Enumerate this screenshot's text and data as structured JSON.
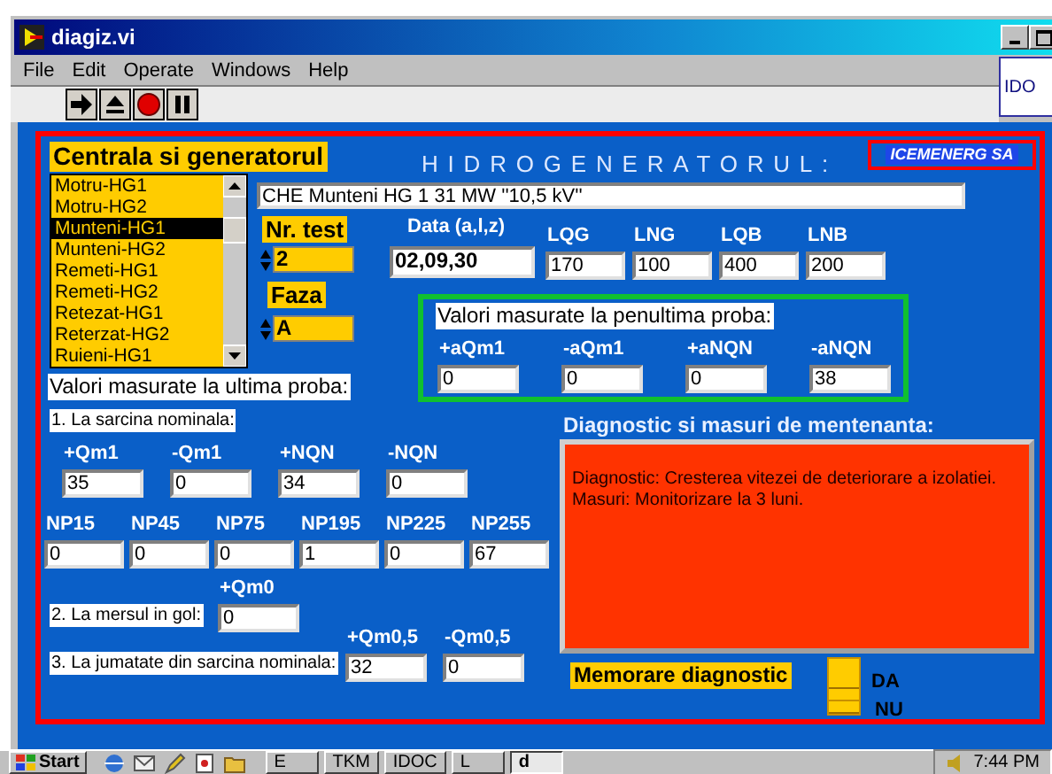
{
  "window": {
    "title": "diagiz.vi"
  },
  "menu": [
    "File",
    "Edit",
    "Operate",
    "Windows",
    "Help"
  ],
  "side_box": {
    "text": "IDO"
  },
  "panel": {
    "station_label": "Centrala si generatorul",
    "heading": "HIDROGENERATORUL:",
    "company": "ICEMENERG SA",
    "generators": [
      {
        "label": "Motru-HG1",
        "selected": false
      },
      {
        "label": "Motru-HG2",
        "selected": false
      },
      {
        "label": "Munteni-HG1",
        "selected": true
      },
      {
        "label": "Munteni-HG2",
        "selected": false
      },
      {
        "label": "Remeti-HG1",
        "selected": false
      },
      {
        "label": "Remeti-HG2",
        "selected": false
      },
      {
        "label": "Retezat-HG1",
        "selected": false
      },
      {
        "label": "Reterzat-HG2",
        "selected": false
      },
      {
        "label": "Ruieni-HG1",
        "selected": false
      }
    ],
    "description": "CHE Munteni  HG 1 31 MW  ''10,5 kV''",
    "test_number": {
      "label": "Nr. test",
      "value": "2"
    },
    "phase": {
      "label": "Faza",
      "value": "A"
    },
    "date": {
      "label": "Data (a,l,z)",
      "value": "02,09,30"
    },
    "lengths": [
      {
        "label": "LQG",
        "value": "170"
      },
      {
        "label": "LNG",
        "value": "100"
      },
      {
        "label": "LQB",
        "value": "400"
      },
      {
        "label": "LNB",
        "value": "200"
      }
    ],
    "previous_test": {
      "title": "Valori masurate la penultima proba:",
      "values": [
        {
          "label": "+aQm1",
          "value": "0"
        },
        {
          "label": "-aQm1",
          "value": "0"
        },
        {
          "label": "+aNQN",
          "value": "0"
        },
        {
          "label": "-aNQN",
          "value": "38"
        }
      ]
    },
    "last_test": {
      "title": "Valori masurate la ultima proba:",
      "nominal": {
        "label": "1. La sarcina nominala:",
        "values": [
          {
            "label": "+Qm1",
            "value": "35"
          },
          {
            "label": "-Qm1",
            "value": "0"
          },
          {
            "label": "+NQN",
            "value": "34"
          },
          {
            "label": "-NQN",
            "value": "0"
          }
        ],
        "np_values": [
          {
            "label": "NP15",
            "value": "0"
          },
          {
            "label": "NP45",
            "value": "0"
          },
          {
            "label": "NP75",
            "value": "0"
          },
          {
            "label": "NP195",
            "value": "1"
          },
          {
            "label": "NP225",
            "value": "0"
          },
          {
            "label": "NP255",
            "value": "67"
          }
        ]
      },
      "no_load": {
        "label": "2. La mersul in gol:",
        "values": [
          {
            "label": "+Qm0",
            "value": "0"
          }
        ]
      },
      "half_load": {
        "label": "3. La jumatate din sarcina nominala:",
        "values": [
          {
            "label": "+Qm0,5",
            "value": "32"
          },
          {
            "label": "-Qm0,5",
            "value": "0"
          }
        ]
      }
    },
    "diagnostic": {
      "title": "Diagnostic si masuri de mentenanta:",
      "lines": [
        "Diagnostic: Cresterea vitezei de deteriorare a izolatiei.",
        "Masuri: Monitorizare la 3 luni."
      ]
    },
    "save": {
      "label": "Memorare diagnostic",
      "on": false,
      "on_label": "DA",
      "off_label": "NU"
    }
  },
  "taskbar": {
    "start": "Start",
    "tasks": [
      {
        "label": "E",
        "selected": false
      },
      {
        "label": "TKM",
        "selected": false
      },
      {
        "label": "IDOC",
        "selected": false
      },
      {
        "label": "L",
        "selected": false
      },
      {
        "label": "d",
        "selected": true
      }
    ],
    "clock": "7:44 PM"
  }
}
